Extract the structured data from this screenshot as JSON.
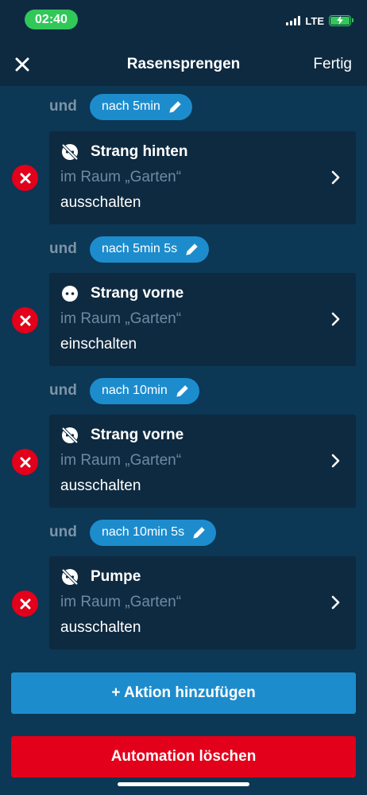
{
  "status_bar": {
    "time": "02:40",
    "network": "LTE"
  },
  "nav": {
    "close_icon": "close-icon",
    "title": "Rasensprengen",
    "done_label": "Fertig"
  },
  "colors": {
    "background": "#0c3755",
    "card": "#0e2a40",
    "accent_blue": "#1d8ccd",
    "danger_red": "#e2001a",
    "muted_text": "#6e8aa3",
    "status_green": "#31c759"
  },
  "steps": [
    {
      "connector": "und",
      "delay": "nach  5min",
      "device": {
        "icon": "socket-off-icon",
        "name": "Strang hinten",
        "room": "im Raum „Garten“",
        "action": "ausschalten"
      }
    },
    {
      "connector": "und",
      "delay": "nach  5min 5s",
      "device": {
        "icon": "socket-on-icon",
        "name": "Strang vorne",
        "room": "im Raum „Garten“",
        "action": "einschalten"
      }
    },
    {
      "connector": "und",
      "delay": "nach  10min",
      "device": {
        "icon": "socket-off-icon",
        "name": "Strang vorne",
        "room": "im Raum „Garten“",
        "action": "ausschalten"
      }
    },
    {
      "connector": "und",
      "delay": "nach  10min 5s",
      "device": {
        "icon": "socket-off-icon",
        "name": "Pumpe",
        "room": "im Raum „Garten“",
        "action": "ausschalten"
      }
    }
  ],
  "buttons": {
    "add_action": "+ Aktion hinzufügen",
    "delete_automation": "Automation löschen"
  }
}
